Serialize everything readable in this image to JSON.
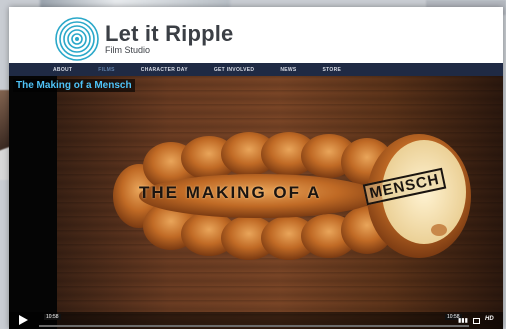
{
  "header": {
    "title": "Let it Ripple",
    "subtitle": "Film Studio"
  },
  "nav": {
    "items": [
      {
        "label": "ABOUT",
        "active": false
      },
      {
        "label": "FILMS",
        "active": true
      },
      {
        "label": "CHARACTER DAY",
        "active": false
      },
      {
        "label": "GET INVOLVED",
        "active": false
      },
      {
        "label": "NEWS",
        "active": false
      },
      {
        "label": "STORE",
        "active": false
      }
    ]
  },
  "video": {
    "title": "The Making of a Mensch",
    "overlay_text": "THE MAKING OF A",
    "stamp_text": "MENSCH",
    "current_time": "10:58",
    "total_time": "10:58",
    "hd_label": "HD"
  },
  "colors": {
    "nav_bg": "#1f2a44",
    "title_accent": "#4fc3f7",
    "active_nav": "#5e7fa8"
  }
}
